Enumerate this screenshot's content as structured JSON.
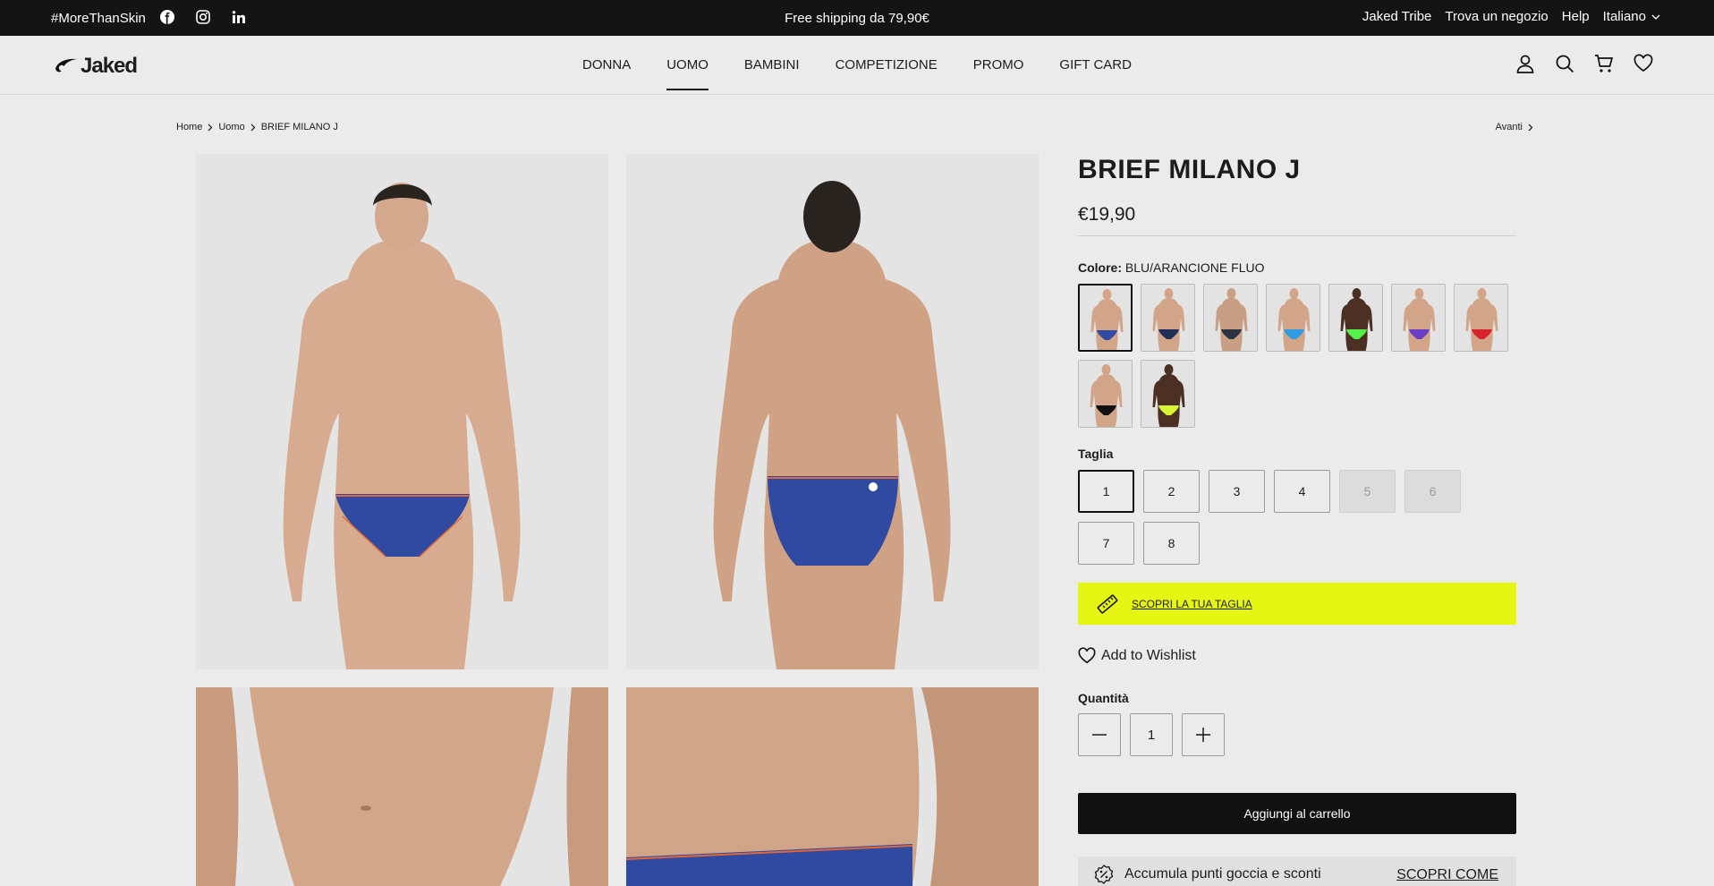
{
  "topbar": {
    "hashtag": "#MoreThanSkin",
    "shipping": "Free shipping da 79,90€",
    "links": [
      "Jaked Tribe",
      "Trova un negozio",
      "Help",
      "Italiano"
    ]
  },
  "header": {
    "logo": "Jaked",
    "nav": [
      "DONNA",
      "UOMO",
      "BAMBINI",
      "COMPETIZIONE",
      "PROMO",
      "GIFT CARD"
    ],
    "active_nav": "UOMO"
  },
  "breadcrumb": {
    "items": [
      "Home",
      "Uomo",
      "BRIEF MILANO J"
    ],
    "next": "Avanti"
  },
  "product": {
    "title": "BRIEF MILANO J",
    "price": "€19,90",
    "color_label": "Colore:",
    "color_value": "BLU/ARANCIONE FLUO",
    "swatches": [
      {
        "brief": "#2f4aa0",
        "skin": "#d2a588",
        "selected": true
      },
      {
        "brief": "#1f2f5a",
        "skin": "#d2a588"
      },
      {
        "brief": "#2b3442",
        "skin": "#c99f84"
      },
      {
        "brief": "#2f9be0",
        "skin": "#d2a588"
      },
      {
        "brief": "#55ef4a",
        "skin": "#4a2f22"
      },
      {
        "brief": "#6a3fc6",
        "skin": "#d2a588"
      },
      {
        "brief": "#d8242c",
        "skin": "#d2a588"
      },
      {
        "brief": "#111111",
        "skin": "#d2a588"
      },
      {
        "brief": "#d7f532",
        "skin": "#4a2f22"
      }
    ],
    "size_label": "Taglia",
    "sizes": [
      {
        "label": "1",
        "state": "selected"
      },
      {
        "label": "2",
        "state": "available"
      },
      {
        "label": "3",
        "state": "available"
      },
      {
        "label": "4",
        "state": "available"
      },
      {
        "label": "5",
        "state": "disabled"
      },
      {
        "label": "6",
        "state": "disabled"
      },
      {
        "label": "7",
        "state": "available"
      },
      {
        "label": "8",
        "state": "available"
      }
    ],
    "size_guide": "SCOPRI LA TUA TAGLIA",
    "wishlist": "Add to Wishlist",
    "quantity_label": "Quantità",
    "quantity": "1",
    "add_to_cart": "Aggiungi al carrello",
    "points_text": "Accumula punti goccia e sconti",
    "points_link": "SCOPRI COME"
  },
  "colors": {
    "topbar": "#141414",
    "size_banner": "#e5f612",
    "brief": "#2f4aa0",
    "brief_trim": "#e0673a"
  }
}
